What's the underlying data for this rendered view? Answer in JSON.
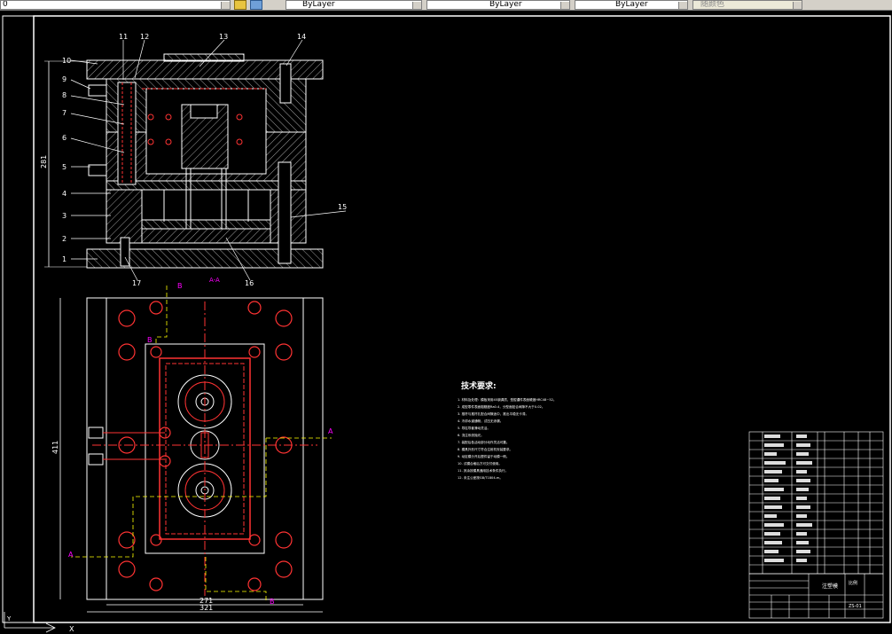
{
  "toolbar": {
    "layer_value": "0",
    "color_value": "ByLayer",
    "linetype_value": "ByLayer",
    "lineweight_value": "ByLayer",
    "plotstyle_value": "随颜色"
  },
  "callouts": [
    "1",
    "2",
    "3",
    "4",
    "5",
    "6",
    "7",
    "8",
    "9",
    "10",
    "11",
    "12",
    "13",
    "14",
    "15",
    "16",
    "17"
  ],
  "dims": {
    "height_side": "281",
    "height_plan": "411",
    "width_inner": "271",
    "width_outer": "321",
    "section_mark": "A-A"
  },
  "section_labels": {
    "b": "B",
    "a": "A"
  },
  "tech_notes": {
    "title": "技术要求:",
    "lines": [
      "1. 材料及处理：模板采用45钢调质，型腔镶件表面硬度HRC48~52。",
      "2. 成型零件表面粗糙度Ra0.4，分型面贴合间隙不大于0.02。",
      "3. 推杆与推杆孔配合间隙适中，推出平稳无卡滞。",
      "4. 冷却水道通畅，试压无渗漏。",
      "5. 导柱导套滑动灵活。",
      "6. 浇注系统抛光。",
      "7. 装配后各活动部分动作灵活可靠。",
      "8. 模具外形尺寸符合注射机安装要求。",
      "9. 动定模分开后塑件留于动模一侧。",
      "10. 试模合格后方可交付使用。",
      "11. 其余按模具通用技术条件执行。",
      "12. 未注公差按GB/T1804-m。"
    ]
  },
  "title_block": {
    "drawing_title": "注塑模",
    "scale_label": "比例",
    "number": "ZS-01"
  },
  "status": {
    "axis_y": "Y",
    "axis_x": "X"
  }
}
